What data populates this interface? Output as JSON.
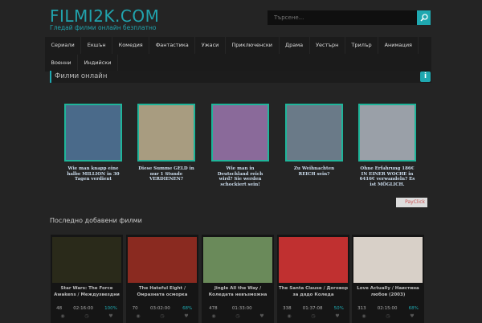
{
  "header": {
    "logo": "FILMI2K.COM",
    "tagline": "Гледай филми онлайн безплатно",
    "search_placeholder": "Търсене..."
  },
  "nav": [
    "Сериали",
    "Екшън",
    "Комедия",
    "Фантастика",
    "Ужаси",
    "Приключенски",
    "Драма",
    "Уестърн",
    "Трилър",
    "Анимация",
    "Военни",
    "Индийски"
  ],
  "section_title": "Филми онлайн",
  "ads": [
    {
      "title": "Wie man knapp eine halbe MILLION in 30 Tagen verdient",
      "color": "#4a6a8a"
    },
    {
      "title": "Diese Summe GELD in nur 1 Stunde VERDIENEN?",
      "color": "#a89c80"
    },
    {
      "title": "Wie man in Deutschland reich wird? Sie werden schockiert sein!",
      "color": "#8a6a9a"
    },
    {
      "title": "Zu Weihnachten REICH sein?",
      "color": "#6a7a88"
    },
    {
      "title": "Ohne Erfahrung 186€ IN EINER WOCHE in 6416€ verwandeln? Es ist MÖGLICH.",
      "color": "#9aa0a8"
    }
  ],
  "ad_badge": "PayClick",
  "recent_title": "Последно добавени филми",
  "movies": [
    {
      "title": "Star Wars: The Force Awakens / Междузвездни",
      "views": "48",
      "duration": "02:16:00",
      "rating": "100%",
      "color": "#2a2a1a"
    },
    {
      "title": "The Hateful Eight / Омразната осморка",
      "views": "70",
      "duration": "03:02:00",
      "rating": "68%",
      "color": "#8a2a20"
    },
    {
      "title": "Jingle All the Way / Коледата невъзможна",
      "views": "478",
      "duration": "01:33:00",
      "rating": "",
      "color": "#6a8a5a"
    },
    {
      "title": "The Santa Clause / Договор за дядо Коледа",
      "views": "338",
      "duration": "01:37:08",
      "rating": "50%",
      "color": "#c03030"
    },
    {
      "title": "Love Actually / Наистина любов (2003)",
      "views": "313",
      "duration": "02:15:00",
      "rating": "68%",
      "color": "#d8d0c8"
    }
  ]
}
